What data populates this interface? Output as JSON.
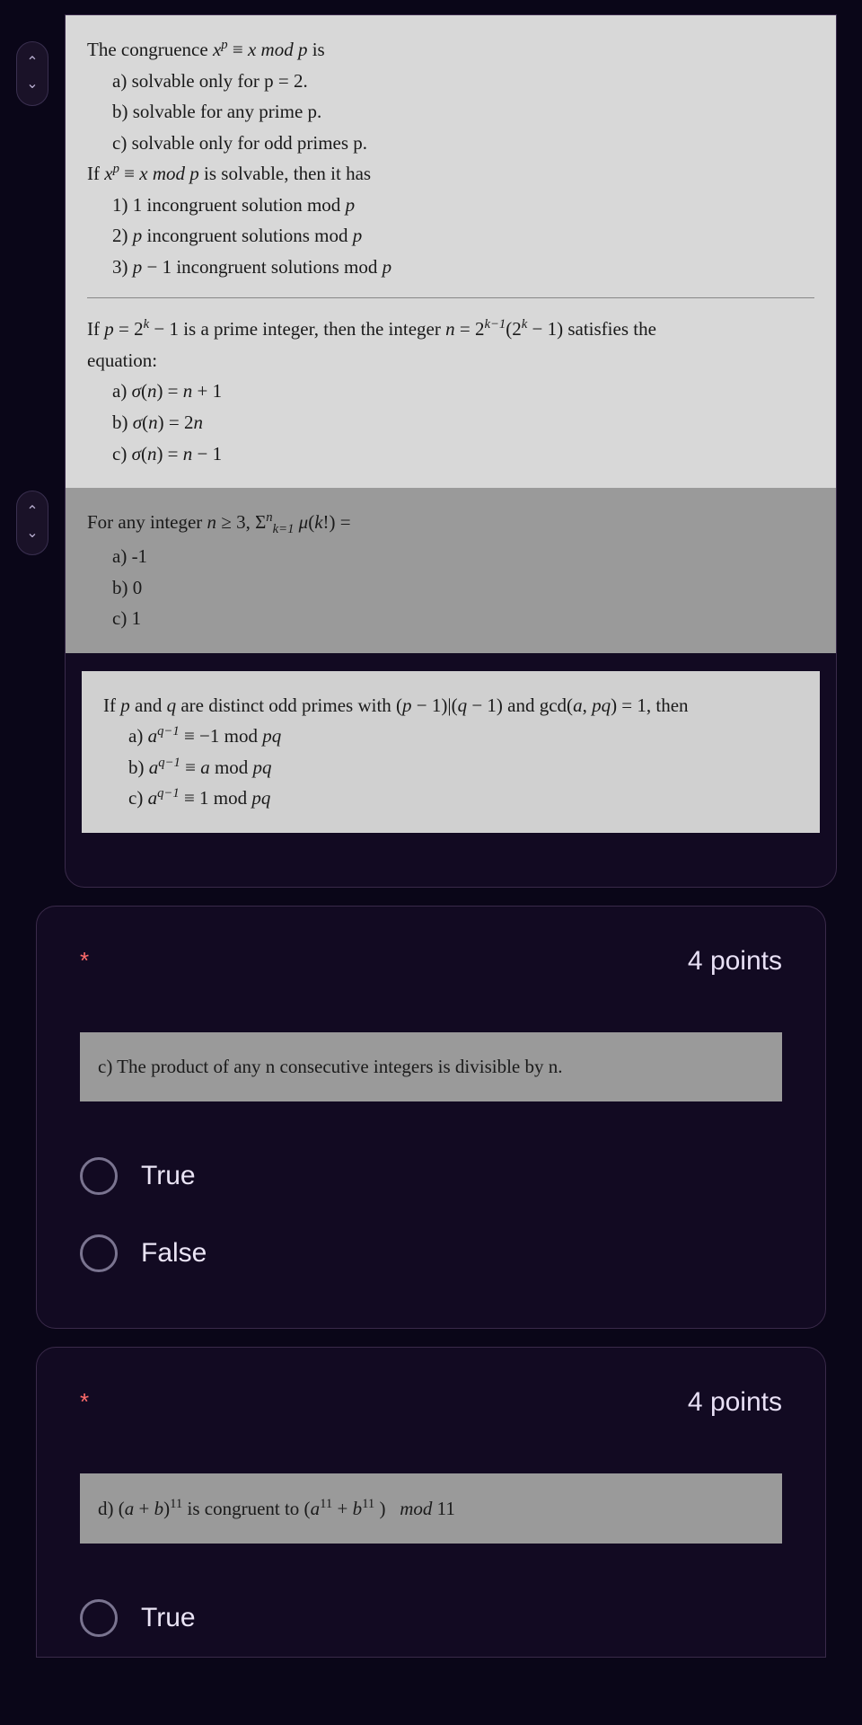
{
  "card1": {
    "block1": {
      "line1_a": "The congruence ",
      "line1_b": " is",
      "math1": "xᵖ ≡ x mod p",
      "opt_a": "a)  solvable only for p = 2.",
      "opt_b": "b)  solvable for any prime p.",
      "opt_c": "c)  solvable only for odd primes p.",
      "line2_a": "If  ",
      "line2_b": " is solvable, then it has",
      "math2": "xᵖ ≡ x mod p",
      "opt_1": "1) 1 incongruent solution mod p",
      "opt_2": "2) p incongruent solutions mod p",
      "opt_3": "3) p − 1 incongruent solutions mod p"
    },
    "block2": {
      "line1": "If p = 2ᵏ − 1 is a prime integer, then the integer n = 2ᵏ⁻¹(2ᵏ − 1) satisfies the",
      "line2": "equation:",
      "opt_a": "a)  σ(n) = n + 1",
      "opt_b": "b)  σ(n) = 2n",
      "opt_c": "c)  σ(n) = n − 1"
    },
    "block3": {
      "line1": "For any integer n ≥ 3,  Σⁿₖ₌₁ μ(k!) =",
      "opt_a": "a)  -1",
      "opt_b": "b)  0",
      "opt_c": "c)  1"
    },
    "block4": {
      "line1": "If p and q are distinct odd primes with (p − 1)|(q − 1) and gcd(a, pq) = 1, then",
      "opt_a": "a)  aᑫ⁻¹ ≡ −1 mod pq",
      "opt_b": "b)  aᑫ⁻¹ ≡ a mod pq",
      "opt_c": "c)  aᑫ⁻¹ ≡ 1 mod pq"
    }
  },
  "card2": {
    "required": "*",
    "points": "4 points",
    "statement": "c)  The product of any n consecutive integers is divisible by n.",
    "opt_true": "True",
    "opt_false": "False"
  },
  "card3": {
    "required": "*",
    "points": "4 points",
    "statement": "d)  (a + b)¹¹ is congruent to (a¹¹ + b¹¹)   mod 11",
    "opt_true": "True"
  }
}
